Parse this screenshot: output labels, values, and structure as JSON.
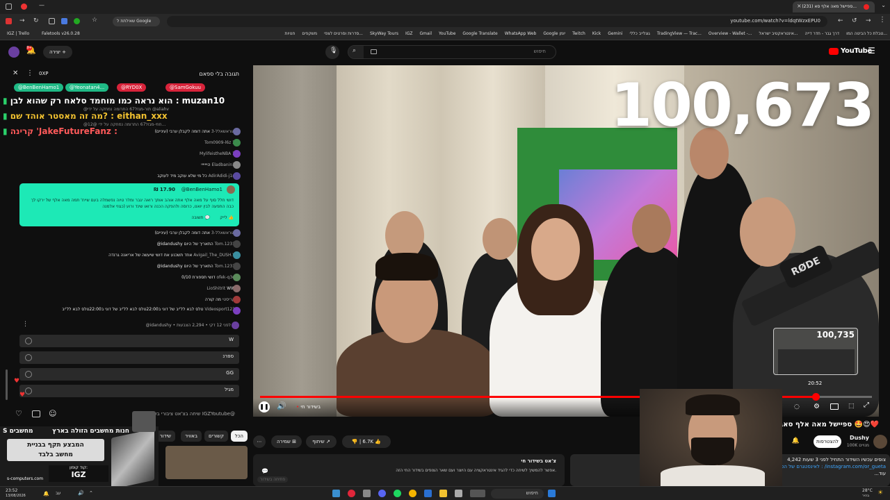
{
  "browser": {
    "tab_title": "(231) ספיישל מאה אלף סא...",
    "tab_left_label": "שאילתת ל Google",
    "url": "youtube.com/watch?v=ldqtWzxEPU0",
    "bookmarks": [
      "IGZ | Trello",
      "Faletools v26.0.28",
      "טבלת כל הביטה המו...",
      "דרך גבר - חדר דייה",
      "אינטראקטיב ישראל...",
      "Overview - Wallet -...",
      "TradingView — Trac...",
      "גוגלייב כללי",
      "Gemini",
      "Kick",
      "Twitch",
      "Google יומן",
      "WhatsApp Web",
      "Google Translate",
      "YouTube",
      "Gmail",
      "IGZ",
      "SkyWay Tours",
      "סדרות וסרטים לצפי...",
      "משקפים",
      "חנויות"
    ]
  },
  "yt_header": {
    "create_label": "יצירה",
    "search_placeholder": "חיפוש",
    "logo_text": "YouTube",
    "logo_sup": "IL"
  },
  "chat": {
    "title": "תגובה בלי ספאם",
    "header_right": "0XP",
    "chips": [
      "@BenBenHamo1",
      "@Yeonatan4...",
      "@RYD0X",
      "@SamGokuu"
    ],
    "chip_colors": [
      "#2ecc9a",
      "#2ecc9a",
      "#e0263a",
      "#e0263a"
    ],
    "big_lines": [
      {
        "text": "הוא נראה כמו מוחמד סלאח רק שהוא לבן : muzan10"
      },
      {
        "text": "מה זה מאסטר אוהד שם? : eithan_xxx"
      },
      {
        "text": "קרינה 'JakeFutureFanz :"
      }
    ],
    "small_meta": [
      "@תור-מגזל67 התרומה נמחקה על ידי @aliahv",
      "@חוזי-מגזל67 התרומה נמחקה על ידי @12..."
    ],
    "messages": [
      {
        "user": "@אוראשאלל-3",
        "text": "אתה דומה לקבלן ערבי (עיניים)"
      },
      {
        "user": "@Tom0909-l6z",
        "text": "1"
      },
      {
        "user": "@MylifeistheNBA",
        "text": "1"
      },
      {
        "user": "@Eladbanin1",
        "text": "הייייייי"
      },
      {
        "user": "@AdirAdidi-j1n",
        "text": "כל מי שלא עוקב מיד לעוקב"
      }
    ],
    "superchat": {
      "user": "@BenBenHamo1",
      "amount": "₪ 17.90",
      "text": "דושי חלל סוף על מאה אלף אתה אוהב אותך רואה יגבר ומלר טיוה נפשמלה בעם שייח' תמה מאה אלף של ירקו לך כבה התפעה לבין יואנו, כרוסה ולהפקה הכנה ורואו שינד ורוע (כגוזי אלמנה",
      "like": "לייק",
      "reply": "תשובה"
    },
    "messages2": [
      {
        "user": "@אוראשאלל-3",
        "text": "אתה דומה לקבלן ערבי (עיניים)"
      },
      {
        "user": "@Tom.1231",
        "text": "התאריך של היום idandushy@"
      },
      {
        "user": "@Avigail_The_DUSH.Y",
        "text": "אחד תשכנע את דושי שיעשה של אריאנה גרנדה"
      },
      {
        "user": "@Tom.1231",
        "text": "התאריך של היום idandushy@"
      },
      {
        "user": "@ofek-q3q",
        "text": "דושי תספורת 0/10"
      },
      {
        "user": "@LioShitrit",
        "text": "WW"
      },
      {
        "user": "@קריסטי",
        "text": "מה קורה"
      },
      {
        "user": "@Videosport123",
        "text": "טלס לבא לל'יב של דוני ב22:00טלס לבא לל'יב של דוני ב22:00טלס לבא לל'יב"
      }
    ],
    "poll_header": "@idandushy • לפני 12 דקי • 2,294 הצבעות",
    "poll_options": [
      "W",
      "ספרנ",
      "GG",
      "מגיל"
    ],
    "input_placeholder": "שיחה בצ'אט ציבורי בשם IGZYoutube@"
  },
  "video": {
    "overlay_count": "100,673",
    "thumb_count": "100,735",
    "preview_time": "20:52",
    "live_label": "בשידור חי"
  },
  "under_video": {
    "title": "ספיישל מאה אלף סאבים",
    "channel": "Dushy",
    "subs": "100K מנויים",
    "join_label": "להצטרפות",
    "likes": "6.7K",
    "share_label": "שיתוף",
    "save_label": "שמירה",
    "desc_stats": "4,242 צופים עכשיו השידור התחיל לפני 3 שעות",
    "desc_line2": "לאינסטגרם של הספר : /instagram.com/or_gueta",
    "desc_line3": "...עוד",
    "tabs": [
      "הכל",
      "קשורים",
      "באוויר",
      "שידור חי"
    ],
    "chat_replay_title": "צ'אט בשידור חי",
    "chat_replay_text": "אפשר להמשיך לשיחה כדי להגיד אינטראקציה עם היוצר ועם שאר הצופים בשידור החי הזה.",
    "chat_replay_btn": "פתיחה בשידור"
  },
  "ad": {
    "headline": "חנות מחשבים הזולה בארץ",
    "brand": "S מחשבים",
    "promo_line1": "המבצע תקף בבניית",
    "promo_line2": "מחשב בלבד",
    "code_label": "קוד קופון:",
    "code": "IGZ",
    "site": "s-computers.com"
  },
  "taskbar": {
    "search": "חיפוש",
    "time": "23:52",
    "date": "13/08/2026",
    "weather": "28°C",
    "weather_sub": "בהיר",
    "lang": "עב"
  }
}
